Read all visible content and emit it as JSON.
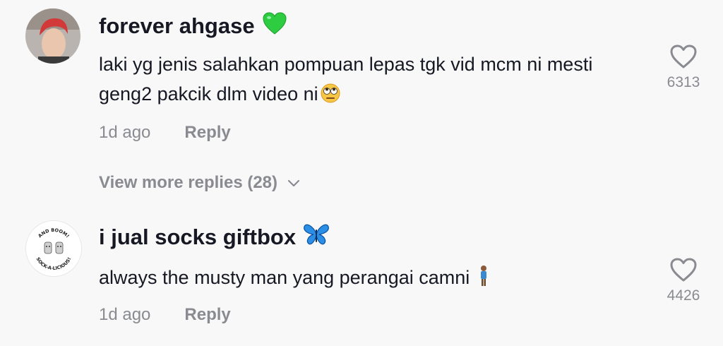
{
  "comments": [
    {
      "username": "forever ahgase",
      "username_emoji": "green-heart-icon",
      "text": "laki yg jenis salahkan pompuan lepas tgk vid mcm ni mesti geng2 pakcik dlm video ni",
      "text_emoji": "eye-roll-emoji-icon",
      "time": "1d ago",
      "reply_label": "Reply",
      "like_count": "6313",
      "view_more": "View more replies (28)"
    },
    {
      "username": "i jual socks giftbox",
      "username_emoji": "butterfly-icon",
      "text": "always the musty man yang perangai camni",
      "text_emoji": "person-standing-emoji-icon",
      "time": "1d ago",
      "reply_label": "Reply",
      "like_count": "4426",
      "avatar_text_top": "AND BOOM!",
      "avatar_text_bottom": "SOCK-A-LICIOUS!"
    }
  ],
  "colors": {
    "background": "#f8f8f8",
    "text_primary": "#161823",
    "text_secondary": "#8a8b91",
    "heart_green": "#2ecc40",
    "butterfly_blue": "#2b8fe8"
  }
}
